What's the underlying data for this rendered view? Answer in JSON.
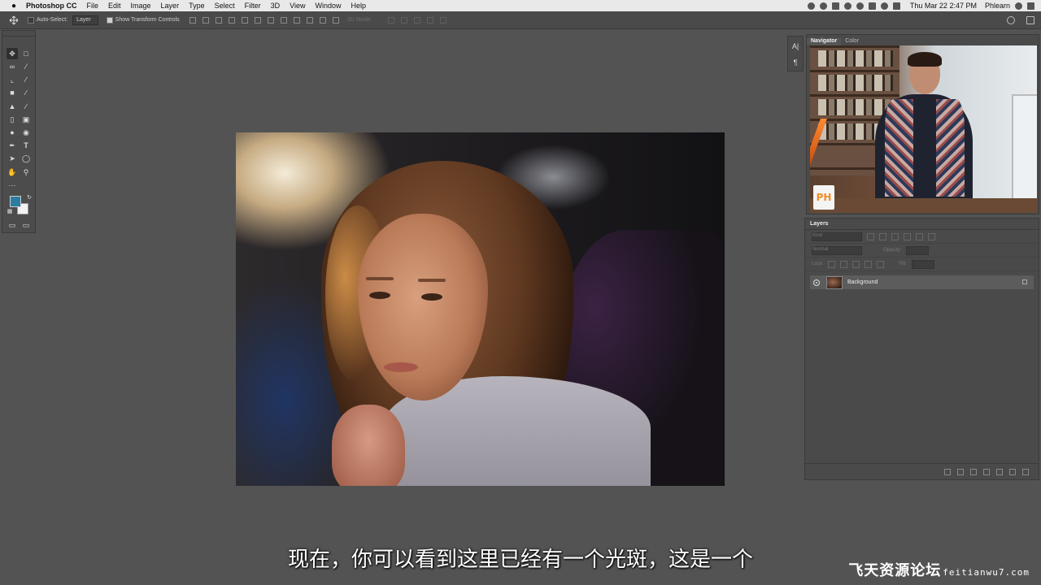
{
  "menubar": {
    "app_name": "Photoshop CC",
    "items": [
      "File",
      "Edit",
      "Image",
      "Layer",
      "Type",
      "Select",
      "Filter",
      "3D",
      "View",
      "Window",
      "Help"
    ],
    "clock": "Thu Mar 22  2:47 PM",
    "user": "Phlearn"
  },
  "options_bar": {
    "auto_select_label": "Auto-Select:",
    "auto_select_value": "Layer",
    "show_transform_label": "Show Transform Controls",
    "mode_3d_label": "3D Mode:"
  },
  "tools": [
    "move-tool-icon",
    "marquee-tool-icon",
    "lasso-tool-icon",
    "magic-wand-tool-icon",
    "crop-tool-icon",
    "eyedropper-tool-icon",
    "healing-brush-tool-icon",
    "brush-tool-icon",
    "clone-stamp-tool-icon",
    "history-brush-tool-icon",
    "eraser-tool-icon",
    "gradient-tool-icon",
    "blur-tool-icon",
    "dodge-tool-icon",
    "pen-tool-icon",
    "type-tool-icon",
    "path-selection-tool-icon",
    "ellipse-tool-icon",
    "hand-tool-icon",
    "zoom-tool-icon"
  ],
  "colors": {
    "foreground": "#2c7da1",
    "background": "#f2f2f2"
  },
  "navigator": {
    "tabs": [
      "Navigator",
      "Color"
    ],
    "active_tab": "Navigator",
    "logo_text": "PH"
  },
  "layers": {
    "title": "Layers",
    "filter_placeholder": "Kind",
    "blend_mode": "Normal",
    "opacity_label": "Opacity:",
    "lock_label": "Lock:",
    "fill_label": "Fill:",
    "items": [
      {
        "name": "Background",
        "visible": true,
        "locked": true
      }
    ]
  },
  "subtitle": "现在，你可以看到这里已经有一个光斑，这是一个",
  "watermark": {
    "text": "飞天资源论坛",
    "url": "feitianwu7.com"
  }
}
